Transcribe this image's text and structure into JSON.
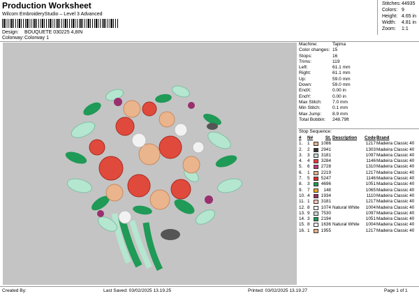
{
  "header": {
    "title": "Production Worksheet",
    "subtitle": "Wilcom EmbroideryStudio – Level 3 Advanced",
    "design_label": "Design:",
    "design_value": "BOUQUETE 030225 4,8IN",
    "colorway_label": "Colorway:",
    "colorway_value": "Colorway 1"
  },
  "stats": [
    {
      "label": "Stitches:",
      "value": "44935"
    },
    {
      "label": "Colors:",
      "value": "9"
    },
    {
      "label": "Height:",
      "value": "4.65 in"
    },
    {
      "label": "Width:",
      "value": "4.81 in"
    },
    {
      "label": "Zoom:",
      "value": "1:1"
    }
  ],
  "properties": [
    {
      "label": "Machine:",
      "value": "Tajima"
    },
    {
      "label": "Color changes:",
      "value": "15"
    },
    {
      "label": "Stops:",
      "value": "16"
    },
    {
      "label": "Trims:",
      "value": "119"
    },
    {
      "label": "Left:",
      "value": "61.1 mm"
    },
    {
      "label": "Right:",
      "value": "61.1 mm"
    },
    {
      "label": "Up:",
      "value": "59.0 mm"
    },
    {
      "label": "Down:",
      "value": "59.0 mm"
    },
    {
      "label": "EndX:",
      "value": "0.00 in"
    },
    {
      "label": "EndY:",
      "value": "0.00 in"
    },
    {
      "label": "Max Stitch:",
      "value": "7.0 mm"
    },
    {
      "label": "Min Stitch:",
      "value": "0.1 mm"
    },
    {
      "label": "Max Jump:",
      "value": "8.9 mm"
    },
    {
      "label": "Total Bobbin:",
      "value": "248.79ft"
    }
  ],
  "sequence": {
    "title": "Stop Sequence:",
    "headers": {
      "num": "#",
      "n": "N#",
      "st": "St.",
      "desc": "Description",
      "code": "Code",
      "brand": "Brand"
    },
    "rows": [
      {
        "num": "1.",
        "n": "1",
        "color": "#e8b28a",
        "st": "1086",
        "desc": "",
        "code": "1217",
        "brand": "Madeira Classic 40"
      },
      {
        "num": "2.",
        "n": "2",
        "color": "#333333",
        "st": "2941",
        "desc": "",
        "code": "1303",
        "brand": "Madeira Classic 40"
      },
      {
        "num": "3.",
        "n": "3",
        "color": "#c9dcd2",
        "st": "3181",
        "desc": "",
        "code": "1097",
        "brand": "Madeira Classic 40"
      },
      {
        "num": "4.",
        "n": "4",
        "color": "#e63b3b",
        "st": "3284",
        "desc": "",
        "code": "1146",
        "brand": "Madeira Classic 40"
      },
      {
        "num": "5.",
        "n": "6",
        "color": "#c23a78",
        "st": "2728",
        "desc": "",
        "code": "1310",
        "brand": "Madeira Classic 40"
      },
      {
        "num": "6.",
        "n": "1",
        "color": "#e8b28a",
        "st": "2219",
        "desc": "",
        "code": "1217",
        "brand": "Madeira Classic 40"
      },
      {
        "num": "7.",
        "n": "5",
        "color": "#e02a2a",
        "st": "5247",
        "desc": "",
        "code": "1146",
        "brand": "Madeira Classic 40"
      },
      {
        "num": "8.",
        "n": "3",
        "color": "#1e9a55",
        "st": "4696",
        "desc": "",
        "code": "1051",
        "brand": "Madeira Classic 40"
      },
      {
        "num": "9.",
        "n": "7",
        "color": "#f0a12a",
        "st": "148",
        "desc": "",
        "code": "1065",
        "brand": "Madeira Classic 40"
      },
      {
        "num": "10.",
        "n": "4",
        "color": "#9a2f6e",
        "st": "1934",
        "desc": "",
        "code": "1110",
        "brand": "Madeira Classic 40"
      },
      {
        "num": "11.",
        "n": "1",
        "color": "#f5c6b8",
        "st": "3181",
        "desc": "",
        "code": "1217",
        "brand": "Madeira Classic 40"
      },
      {
        "num": "12.",
        "n": "8",
        "color": "#f2f2f2",
        "st": "1074",
        "desc": "Natural White",
        "code": "1004",
        "brand": "Madeira Classic 40"
      },
      {
        "num": "13.",
        "n": "9",
        "color": "#c9dcd2",
        "st": "7530",
        "desc": "",
        "code": "1097",
        "brand": "Madeira Classic 40"
      },
      {
        "num": "14.",
        "n": "3",
        "color": "#1e9a55",
        "st": "2194",
        "desc": "",
        "code": "1051",
        "brand": "Madeira Classic 40"
      },
      {
        "num": "15.",
        "n": "8",
        "color": "#f2f2f2",
        "st": "1636",
        "desc": "Natural White",
        "code": "1004",
        "brand": "Madeira Classic 40"
      },
      {
        "num": "16.",
        "n": "1",
        "color": "#e8b28a",
        "st": "1955",
        "desc": "",
        "code": "1217",
        "brand": "Madeira Classic 40"
      }
    ]
  },
  "footer": {
    "created": "Created By:",
    "saved": "Last Saved: 03/02/2025 13.19.25",
    "printed": "Printed: 03/02/2025 13.19.27",
    "page": "Page 1 of 1"
  },
  "colors": {
    "canvas_bg": "#c4c4c4",
    "rose_red": "#e04a3c",
    "rose_peach": "#eab48c",
    "leaf_green": "#1f9a57",
    "leaf_mint": "#b5e6d0",
    "flower_purple": "#9a2f6e",
    "flower_white": "#f2f2f2"
  },
  "artwork": {
    "name": "BOUQUETE 030225 4,8IN",
    "icon": "embroidery-bouquet-preview"
  }
}
